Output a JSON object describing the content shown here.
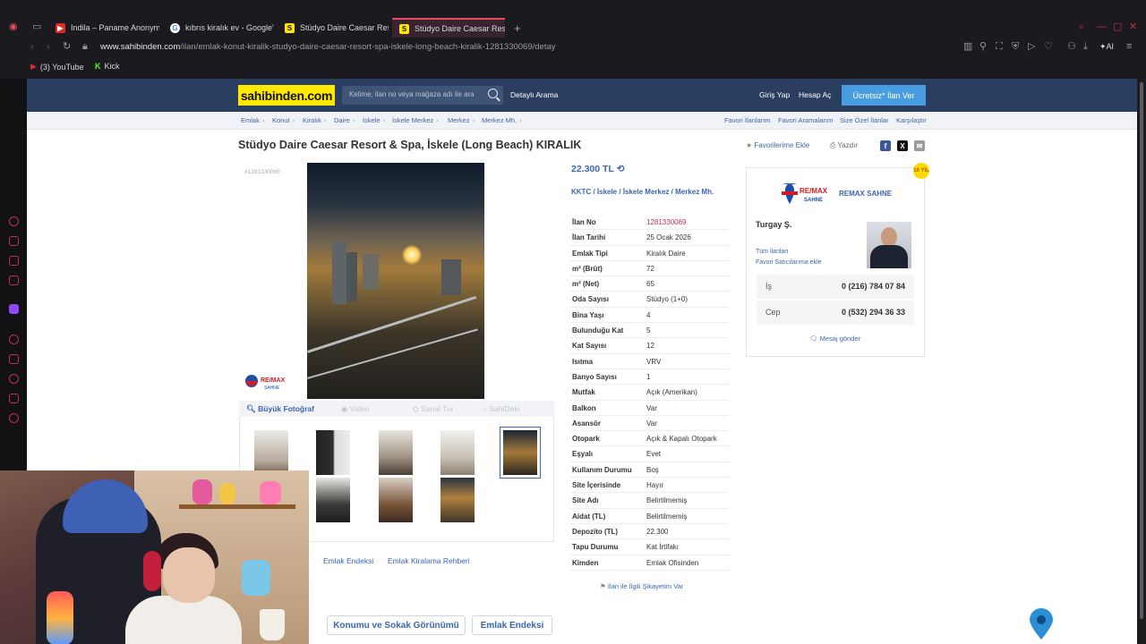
{
  "browser": {
    "tabs": [
      {
        "label": "Indila – Paname Anonyme",
        "favicon_color": "#e02a2a",
        "glyph": "▶"
      },
      {
        "label": "kıbrıs kiralık ev - Google'd",
        "favicon_color": "#ffffff",
        "glyph": "G"
      },
      {
        "label": "Stüdyo Daire Caesar Reso",
        "favicon_color": "#ffe800",
        "glyph": "S"
      },
      {
        "label": "Stüdyo Daire Caesar Reso",
        "favicon_color": "#ffe800",
        "glyph": "S"
      }
    ],
    "url_host": "www.sahibinden.com",
    "url_path": "/ilan/emlak-konut-kiralik-studyo-daire-caesar-resort-spa-iskele-long-beach-kiralik-1281330069/detay",
    "bookmarks": [
      {
        "label": "(3) YouTube",
        "glyph": "▶",
        "color": "#e02a2a"
      },
      {
        "label": "Kick",
        "glyph": "K",
        "color": "#53fc18"
      }
    ],
    "ai_label": "AI"
  },
  "site": {
    "logo": "sahibinden.com",
    "search_placeholder": "Kelime, ilan no veya mağaza adı ile ara",
    "advanced_search": "Detaylı Arama",
    "login": "Giriş Yap",
    "register": "Hesap Aç",
    "cta": "Ücretsiz* İlan Ver",
    "breadcrumbs": [
      "Emlak",
      "Konut",
      "Kiralık",
      "Daire",
      "İskele",
      "İskele Merkez",
      "Merkez",
      "Merkez Mh."
    ],
    "right_links": [
      "Favori İlanlarım",
      "Favori Aramalarım",
      "Size Özel İlanlar",
      "Karşılaştır"
    ]
  },
  "listing": {
    "title": "Stüdyo Daire Caesar Resort & Spa, İskele (Long Beach) KIRALIK",
    "add_favorite": "Favorilerime Ekle",
    "print": "Yazdır",
    "id_small": "#1281330069",
    "price": "22.300 TL",
    "location": [
      "KKTC",
      "İskele",
      "İskele Merkez",
      "Merkez Mh."
    ],
    "media_tabs": [
      "Büyük Fotoğraf",
      "Video",
      "Sanal Tur",
      "SahiDeki"
    ],
    "bottom_links": [
      "Emlak Endeksi",
      "Emlak Kiralama Rehberi"
    ],
    "bottom_buttons": [
      "Konumu ve Sokak Görünümü",
      "Emlak Endeksi"
    ],
    "complaint": "İlan ile İlgili Şikayetim Var",
    "props": [
      {
        "k": "İlan No",
        "v": "1281330069"
      },
      {
        "k": "İlan Tarihi",
        "v": "25 Ocak 2026"
      },
      {
        "k": "Emlak Tipi",
        "v": "Kiralık Daire"
      },
      {
        "k": "m² (Brüt)",
        "v": "72"
      },
      {
        "k": "m² (Net)",
        "v": "65"
      },
      {
        "k": "Oda Sayısı",
        "v": "Stüdyo (1+0)"
      },
      {
        "k": "Bina Yaşı",
        "v": "4"
      },
      {
        "k": "Bulunduğu Kat",
        "v": "5"
      },
      {
        "k": "Kat Sayısı",
        "v": "12"
      },
      {
        "k": "Isıtma",
        "v": "VRV"
      },
      {
        "k": "Banyo Sayısı",
        "v": "1"
      },
      {
        "k": "Mutfak",
        "v": "Açık (Amerikan)"
      },
      {
        "k": "Balkon",
        "v": "Var"
      },
      {
        "k": "Asansör",
        "v": "Var"
      },
      {
        "k": "Otopark",
        "v": "Açık & Kapalı Otopark"
      },
      {
        "k": "Eşyalı",
        "v": "Evet"
      },
      {
        "k": "Kullanım Durumu",
        "v": "Boş"
      },
      {
        "k": "Site İçerisinde",
        "v": "Hayır"
      },
      {
        "k": "Site Adı",
        "v": "Belirtilmemiş"
      },
      {
        "k": "Aidat (TL)",
        "v": "Belirtilmemiş"
      },
      {
        "k": "Depozito (TL)",
        "v": "22.300"
      },
      {
        "k": "Tapu Durumu",
        "v": "Kat İrtifakı"
      },
      {
        "k": "Kimden",
        "v": "Emlak Ofisinden"
      }
    ]
  },
  "agent": {
    "office": "REMAX SAHNE",
    "brand_top": "RE/MAX",
    "brand_bottom": "SAHNE",
    "name": "Turgay Ş.",
    "all_listings": "Tüm ilanları",
    "add_fav_seller": "Favori Satıcılarıma ekle",
    "phones": [
      {
        "label": "İş",
        "number": "0 (216) 784 07 84"
      },
      {
        "label": "Cep",
        "number": "0 (532) 294 36 33"
      }
    ],
    "message": "Mesaj gönder",
    "badge": "16 YIL"
  }
}
